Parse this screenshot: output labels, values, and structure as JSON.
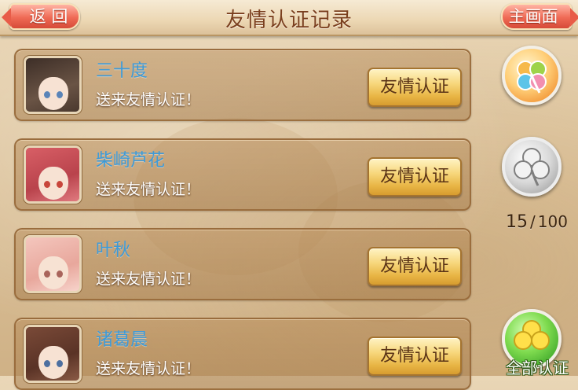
{
  "header": {
    "title": "友情认证记录",
    "back_label": "返 回",
    "home_label": "主画面"
  },
  "records": [
    {
      "name": "三十度",
      "message": "送来友情认证！",
      "button_label": "友情认证"
    },
    {
      "name": "柴崎芦花",
      "message": "送来友情认证！",
      "button_label": "友情认证"
    },
    {
      "name": "叶秋",
      "message": "送来友情认证！",
      "button_label": "友情认证"
    },
    {
      "name": "诸葛晨",
      "message": "送来友情认证！",
      "button_label": "友情认证"
    }
  ],
  "side": {
    "count_current": "15",
    "count_separator": "/",
    "count_max": "100",
    "all_button_label": "全部认证",
    "icons": [
      "four-leaf-clover-icon",
      "silver-clover-icon",
      "green-clover-icon"
    ]
  },
  "colors": {
    "name": "#3d9ad8",
    "title": "#7a3f1e",
    "nav_button": "#ef6a55",
    "confirm_button": "#f7d77c"
  }
}
